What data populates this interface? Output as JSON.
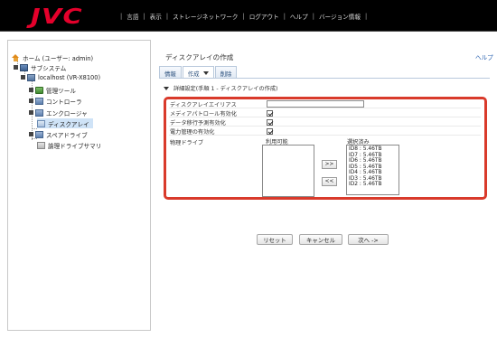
{
  "header": {
    "logo_text": "JVC",
    "menu": [
      "言語",
      "表示",
      "ストレージネットワーク",
      "ログアウト",
      "ヘルプ",
      "バージョン情報"
    ]
  },
  "tree": {
    "home": "ホーム (ユーザー: admin)",
    "system": "サブシステム",
    "host": "localhost (VR-X8100)",
    "items": [
      "管理ツール",
      "コントローラ",
      "エンクロージャ",
      "ディスクアレイ",
      "スペアドライブ",
      "論理ドライブサマリ"
    ]
  },
  "main": {
    "title": "ディスクアレイの作成",
    "help": "ヘルプ",
    "tabs": [
      "情報",
      "作成",
      "削除"
    ],
    "section": "詳細設定(手順 1 - ディスクアレイの作成)",
    "fields": {
      "alias_label": "ディスクアレイエイリアス",
      "alias_value": "",
      "media_patrol_label": "メディアパトロール有効化",
      "predictive_migration_label": "データ移行予測有効化",
      "power_mgmt_label": "電力管理の有効化",
      "physical_drives_label": "物理ドライブ"
    },
    "available_label": "利用可能",
    "available_items": [],
    "selected_label": "選択済み",
    "selected_items": [
      "ID8 : 5.46TB",
      "ID7 : 5.46TB",
      "ID6 : 5.46TB",
      "ID5 : 5.46TB",
      "ID4 : 5.46TB",
      "ID3 : 5.46TB",
      "ID2 : 5.46TB"
    ],
    "move_right": ">>",
    "move_left": "<<",
    "buttons": {
      "reset": "リセット",
      "cancel": "キャンセル",
      "next": "次へ ->"
    }
  },
  "colors": {
    "brand": "#e4002b",
    "highlight_box": "#d93a2b",
    "selection": "#cfe3f7"
  }
}
